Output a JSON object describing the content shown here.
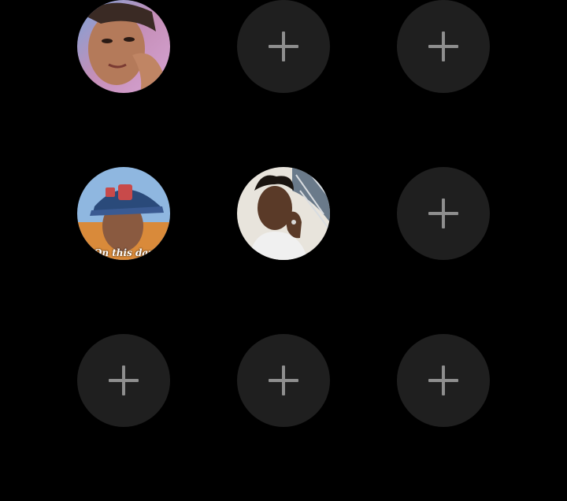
{
  "highlights": {
    "slots": [
      {
        "type": "photo",
        "subject": "woman-selfie"
      },
      {
        "type": "add",
        "icon": "plus-icon"
      },
      {
        "type": "add",
        "icon": "plus-icon"
      },
      {
        "type": "photo",
        "subject": "man-in-cap",
        "overlay_text": "On this day"
      },
      {
        "type": "photo",
        "subject": "man-with-ring"
      },
      {
        "type": "add",
        "icon": "plus-icon"
      },
      {
        "type": "add",
        "icon": "plus-icon"
      },
      {
        "type": "add",
        "icon": "plus-icon"
      },
      {
        "type": "add",
        "icon": "plus-icon"
      }
    ]
  },
  "colors": {
    "background": "#000000",
    "empty_slot": "#1f1f1f",
    "plus_icon": "#8e8e8e"
  }
}
